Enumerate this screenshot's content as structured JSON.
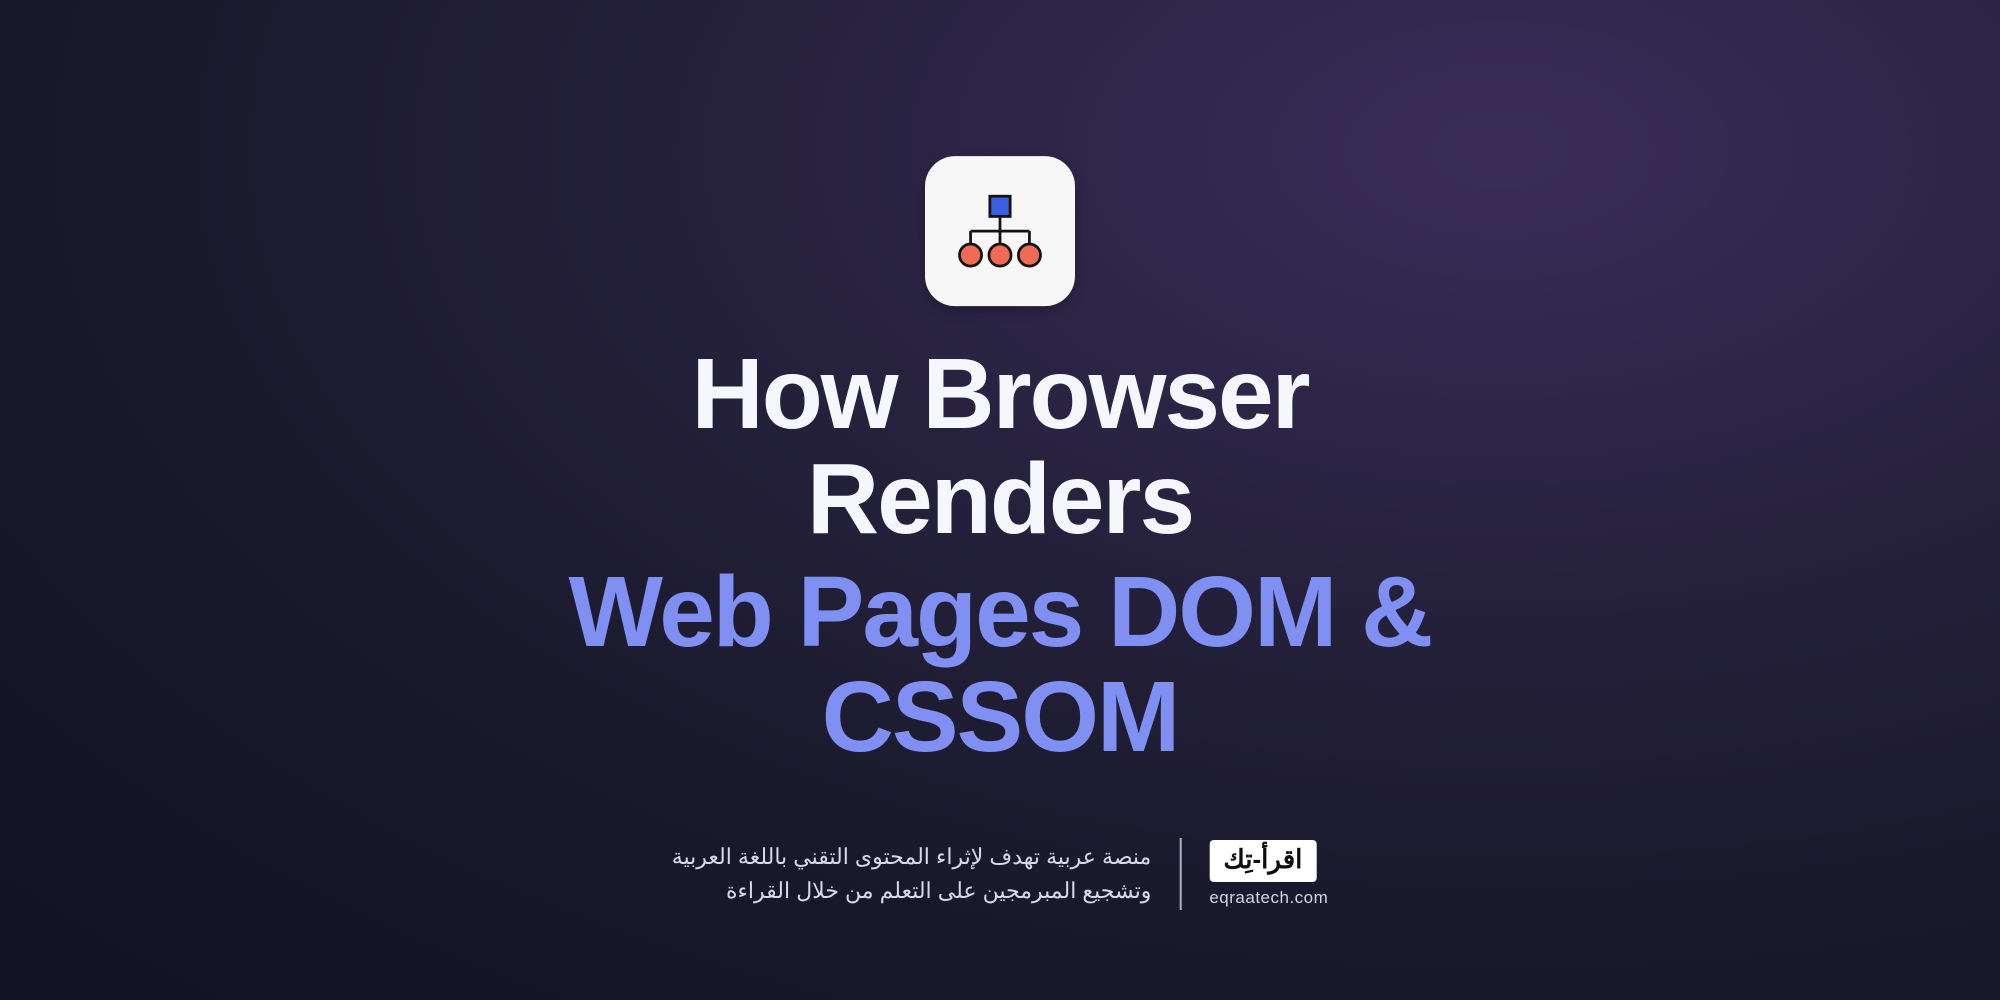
{
  "icon": {
    "name": "sitemap-tree-icon",
    "node_color": "#3b5ee0",
    "leaf_color": "#f16a55",
    "line_color": "#121212"
  },
  "title": {
    "line1": "How Browser Renders",
    "line2": "Web Pages DOM & CSSOM"
  },
  "footer": {
    "tagline_line1": "منصة عربية تهدف لإثراء المحتوى التقني باللغة العربية",
    "tagline_line2": "وتشجيع المبرمجين على التعلم من خلال القراءة",
    "brand_label": "اقرأ-تِك",
    "brand_url": "eqraatech.com"
  },
  "colors": {
    "bg_main": "#181828",
    "bg_glow": "#3a2d5a",
    "text_primary": "#f5f7fc",
    "text_accent": "#7f8ff2"
  }
}
